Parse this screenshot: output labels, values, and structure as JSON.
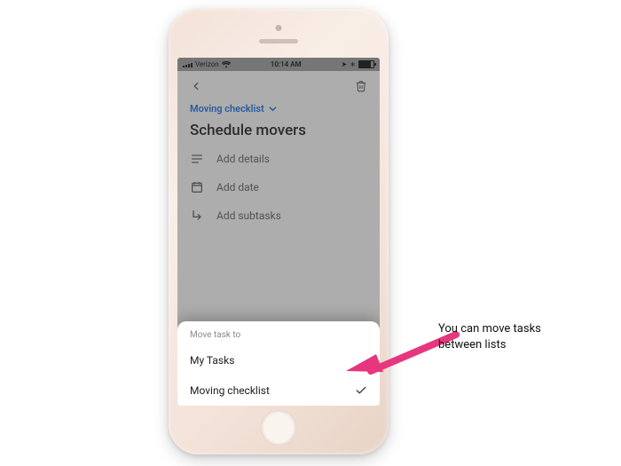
{
  "status_bar": {
    "carrier": "Verizon",
    "time": "10:14 AM",
    "icons": {
      "bluetooth": "✽",
      "locating": "⦿"
    }
  },
  "app": {
    "list_name": "Moving checklist",
    "task_title": "Schedule movers",
    "actions": {
      "details": "Add details",
      "date": "Add date",
      "subtasks": "Add subtasks"
    }
  },
  "sheet": {
    "header": "Move task to",
    "options": [
      {
        "label": "My Tasks",
        "selected": false
      },
      {
        "label": "Moving checklist",
        "selected": true
      }
    ]
  },
  "annotation": {
    "line1": "You can move tasks",
    "line2": "between lists"
  },
  "colors": {
    "accent": "#1a73e8",
    "arrow": "#e7357e"
  }
}
